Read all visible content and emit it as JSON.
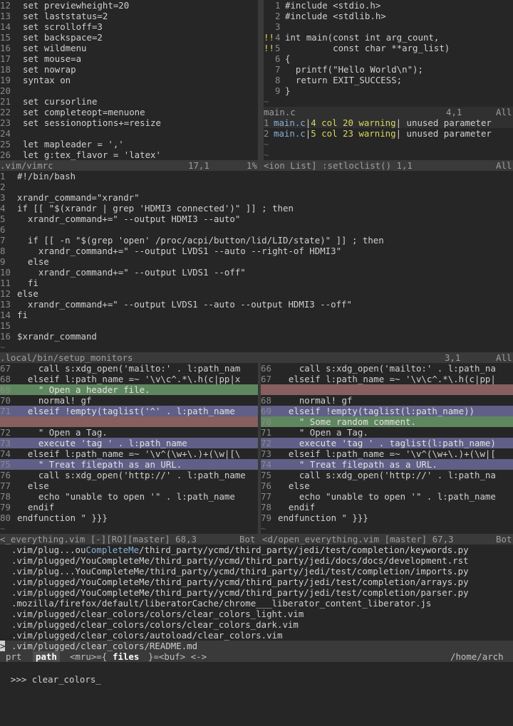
{
  "vimrc": {
    "lines": [
      {
        "n": "12",
        "t": "set previewheight=20"
      },
      {
        "n": "13",
        "t": "set laststatus=2"
      },
      {
        "n": "14",
        "t": "set scrolloff=3"
      },
      {
        "n": "15",
        "t": "set backspace=2"
      },
      {
        "n": "16",
        "t": "set wildmenu"
      },
      {
        "n": "17",
        "t": "set mouse=a"
      },
      {
        "n": "18",
        "t": "set nowrap"
      },
      {
        "n": "19",
        "t": "syntax on"
      },
      {
        "n": "20",
        "t": ""
      },
      {
        "n": "21",
        "t": "set cursorline"
      },
      {
        "n": "22",
        "t": "set completeopt=menuone"
      },
      {
        "n": "23",
        "t": "set sessionoptions+=resize"
      },
      {
        "n": "24",
        "t": ""
      },
      {
        "n": "25",
        "t": "let mapleader = ','"
      },
      {
        "n": "26",
        "t": "let g:tex_flavor = 'latex'"
      }
    ],
    "status": {
      "name": ".vim/vimrc",
      "pos": "17,1",
      "pct": "1%"
    }
  },
  "mainc": {
    "lines": [
      {
        "n": "1",
        "t": "#include <stdio.h>"
      },
      {
        "n": "2",
        "t": "#include <stdlib.h>"
      },
      {
        "n": "3",
        "t": ""
      },
      {
        "n": "4",
        "t": "int main(const int arg_count,"
      },
      {
        "n": "5",
        "t": "         const char **arg_list)"
      },
      {
        "n": "6",
        "t": "{"
      },
      {
        "n": "7",
        "t": "  printf(\"Hello World\\n\");"
      },
      {
        "n": "8",
        "t": "  return EXIT_SUCCESS;"
      },
      {
        "n": "9",
        "t": "}"
      }
    ],
    "signs": {
      "4": "!!",
      "5": "!!"
    },
    "status": {
      "name": "main.c",
      "pos": "4,1",
      "pct": "All"
    }
  },
  "loclist": {
    "items": [
      {
        "n": "1",
        "file": "main.c",
        "loc": "4 col 20 warning",
        "msg": " unused parameter"
      },
      {
        "n": "2",
        "file": "main.c",
        "loc": "5 col 23 warning",
        "msg": " unused parameter"
      }
    ],
    "status": {
      "name": "<ion List] :setloclist() 1,1",
      "pct": "All"
    }
  },
  "script": {
    "lines": [
      {
        "n": "1",
        "t": "#!/bin/bash"
      },
      {
        "n": "2",
        "t": ""
      },
      {
        "n": "3",
        "t": "xrandr_command=\"xrandr\""
      },
      {
        "n": "4",
        "t": "if [[ \"$(xrandr | grep 'HDMI3 connected')\" ]] ; then"
      },
      {
        "n": "5",
        "t": "  xrandr_command+=\" --output HDMI3 --auto\""
      },
      {
        "n": "6",
        "t": ""
      },
      {
        "n": "7",
        "t": "  if [[ -n \"$(grep 'open' /proc/acpi/button/lid/LID/state)\" ]] ; then"
      },
      {
        "n": "8",
        "t": "    xrandr_command+=\" --output LVDS1 --auto --right-of HDMI3\""
      },
      {
        "n": "9",
        "t": "  else"
      },
      {
        "n": "10",
        "t": "    xrandr_command+=\" --output LVDS1 --off\""
      },
      {
        "n": "11",
        "t": "  fi"
      },
      {
        "n": "12",
        "t": "else"
      },
      {
        "n": "13",
        "t": "  xrandr_command+=\" --output LVDS1 --auto --output HDMI3 --off\""
      },
      {
        "n": "14",
        "t": "fi"
      },
      {
        "n": "15",
        "t": ""
      },
      {
        "n": "16",
        "t": "$xrandr_command"
      }
    ],
    "status": {
      "name": ".local/bin/setup_monitors",
      "pos": "3,1",
      "pct": "All"
    }
  },
  "diff_left": {
    "lines": [
      {
        "n": "67",
        "t": "    call s:xdg_open('mailto:' . l:path_nam",
        "hl": ""
      },
      {
        "n": "68",
        "t": "  elseif l:path_name =~ '\\v\\c^.*\\.h(c|pp|x",
        "hl": ""
      },
      {
        "n": "69",
        "t": "    \" Open a header file.",
        "hl": "green"
      },
      {
        "n": "70",
        "t": "    normal! gf",
        "hl": ""
      },
      {
        "n": "71",
        "t": "  elseif !empty(taglist('^' . l:path_name ",
        "hl": "purple"
      },
      {
        "n": "",
        "t": "",
        "hl": "red"
      },
      {
        "n": "72",
        "t": "    \" Open a Tag.",
        "hl": ""
      },
      {
        "n": "73",
        "t": "    execute 'tag ' . l:path_name",
        "hl": "purple"
      },
      {
        "n": "74",
        "t": "  elseif l:path_name =~ '\\v^(\\w+\\.)+(\\w|[\\",
        "hl": ""
      },
      {
        "n": "75",
        "t": "    \" Treat filepath as an URL.",
        "hl": "purple"
      },
      {
        "n": "76",
        "t": "    call s:xdg_open('http://' . l:path_name",
        "hl": ""
      },
      {
        "n": "77",
        "t": "  else",
        "hl": ""
      },
      {
        "n": "78",
        "t": "    echo \"unable to open '\" . l:path_name ",
        "hl": ""
      },
      {
        "n": "79",
        "t": "  endif",
        "hl": ""
      },
      {
        "n": "80",
        "t": "endfunction \" }}}",
        "hl": ""
      }
    ],
    "status": {
      "name": "<_everything.vim [-][RO][master] 68,3",
      "pct": "Bot"
    }
  },
  "diff_right": {
    "lines": [
      {
        "n": "66",
        "t": "    call s:xdg_open('mailto:' . l:path_na",
        "hl": ""
      },
      {
        "n": "67",
        "t": "  elseif l:path_name =~ '\\v\\c^.*\\.h(c|pp|",
        "hl": ""
      },
      {
        "n": "",
        "t": "",
        "hl": "red"
      },
      {
        "n": "68",
        "t": "    normal! gf",
        "hl": ""
      },
      {
        "n": "69",
        "t": "  elseif !empty(taglist(l:path_name))",
        "hl": "purple"
      },
      {
        "n": "70",
        "t": "    \" Some random comment.",
        "hl": "green"
      },
      {
        "n": "71",
        "t": "    \" Open a Tag.",
        "hl": ""
      },
      {
        "n": "72",
        "t": "    execute 'tag ' . taglist(l:path_name)",
        "hl": "purple"
      },
      {
        "n": "73",
        "t": "  elseif l:path_name =~ '\\v^(\\w+\\.)+(\\w|[",
        "hl": ""
      },
      {
        "n": "74",
        "t": "    \" Treat filepath as a URL.",
        "hl": "purple"
      },
      {
        "n": "75",
        "t": "    call s:xdg_open('http://' . l:path_na",
        "hl": ""
      },
      {
        "n": "76",
        "t": "  else",
        "hl": ""
      },
      {
        "n": "77",
        "t": "    echo \"unable to open '\" . l:path_name",
        "hl": ""
      },
      {
        "n": "78",
        "t": "  endif",
        "hl": ""
      },
      {
        "n": "79",
        "t": "endfunction \" }}}",
        "hl": ""
      }
    ],
    "status": {
      "name": "<d/open_everything.vim [master] 67,3",
      "pct": "Bot"
    }
  },
  "ctrlp": {
    "items": [
      {
        "pre": ".vim/plug...ou",
        "m": "CompleteMe",
        "post": "/third_party/ycmd/third_party/jedi/test/completion/keywords.py"
      },
      {
        "pre": ".vim/plugged/YouCompleteMe/third_party/ycmd/third_party/jedi/docs/docs/development.rst",
        "m": "",
        "post": ""
      },
      {
        "pre": ".vim/plug...YouCompleteMe/third_party/ycmd/third_party/jedi/test/completion/imports.py",
        "m": "",
        "post": ""
      },
      {
        "pre": ".vim/plugged/YouCompleteMe/third_party/ycmd/third_party/jedi/test/completion/arrays.py",
        "m": "",
        "post": ""
      },
      {
        "pre": ".vim/plugged/YouCompleteMe/third_party/ycmd/third_party/jedi/test/completion/parser.py",
        "m": "",
        "post": ""
      },
      {
        "pre": ".mozilla/firefox/default/liberatorCache/chrome___liberator_content_liberator.js",
        "m": "",
        "post": ""
      },
      {
        "pre": ".vim/plugged/clear_colors/colors/clear_colors_light.vim",
        "m": "",
        "post": ""
      },
      {
        "pre": ".vim/plugged/clear_colors/colors/clear_colors_dark.vim",
        "m": "",
        "post": ""
      },
      {
        "pre": ".vim/plugged/clear_colors/autoload/clear_colors.vim",
        "m": "",
        "post": ""
      },
      {
        "pre": ".vim/plugged/clear_colors/README.md",
        "m": "",
        "post": ""
      }
    ],
    "bar": {
      "prt": "prt",
      "mode": "path",
      "mru": "<mru>={",
      "files": "files",
      "buf": "}=<buf> <->",
      "cwd": "/home/arch"
    },
    "prompt": ">>> ",
    "query": "clear_colors",
    "cursor": "_"
  },
  "colors": {
    "bg": "#262626",
    "status": "#3a3a3a",
    "green": "#5f875f",
    "red": "#875f5f",
    "purple": "#5f5f87"
  }
}
